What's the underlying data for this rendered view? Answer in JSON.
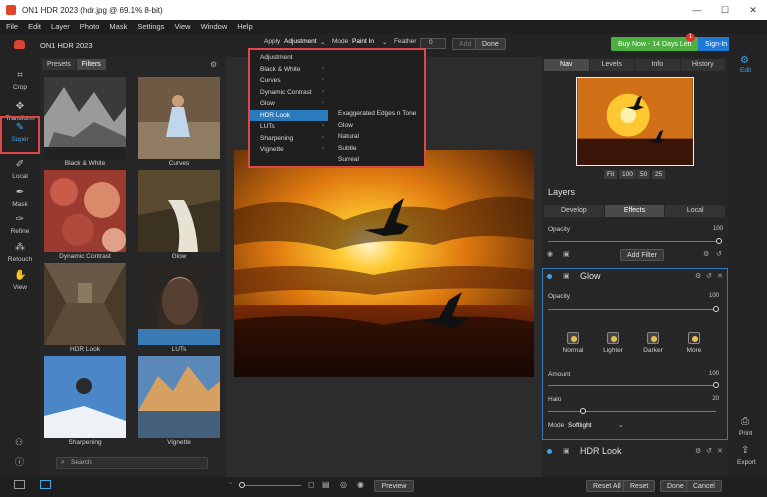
{
  "window": {
    "title": "ON1 HDR 2023 (hdr.jpg @ 69.1% 8-bit)",
    "controls": {
      "minimize": "—",
      "maximize": "☐",
      "close": "✕"
    }
  },
  "menu": [
    "File",
    "Edit",
    "Layer",
    "Photo",
    "Mask",
    "Settings",
    "View",
    "Window",
    "Help"
  ],
  "brand": {
    "name": "ON1 HDR 2023"
  },
  "header": {
    "buy_label": "Buy Now - 14 Days Left",
    "buy_badge": "1",
    "signin_label": "Sign-In",
    "edit_label": "Edit"
  },
  "toolbar": {
    "apply_label": "Apply",
    "apply_value": "Adjustment",
    "mode_label": "Mode",
    "mode_value": "Paint In",
    "feather_label": "Feather",
    "feather_value": "0",
    "add_label": "Add",
    "done_label": "Done"
  },
  "tools": [
    {
      "label": "Crop",
      "icon": "crop-icon",
      "glyph": "⌗"
    },
    {
      "label": "Transform",
      "icon": "transform-icon",
      "glyph": "✥"
    },
    {
      "label": "Super",
      "icon": "super-brush-icon",
      "glyph": "✎"
    },
    {
      "label": "Local",
      "icon": "local-brush-icon",
      "glyph": "✐"
    },
    {
      "label": "Mask",
      "icon": "mask-icon",
      "glyph": "✒"
    },
    {
      "label": "Refine",
      "icon": "refine-icon",
      "glyph": "✑"
    },
    {
      "label": "Retouch",
      "icon": "retouch-icon",
      "glyph": "⁂"
    },
    {
      "label": "View",
      "icon": "view-icon",
      "glyph": "✋"
    }
  ],
  "browser": {
    "tabs": [
      "Presets",
      "Filters"
    ],
    "filters": [
      "Black & White",
      "Curves",
      "Dynamic Contrast",
      "Glow",
      "HDR Look",
      "LUTs",
      "Sharpening",
      "Vignette"
    ],
    "search_placeholder": "Search"
  },
  "dropdown": {
    "items": [
      "Adjustment",
      "Black & White",
      "Curves",
      "Dynamic Contrast",
      "Glow",
      "HDR Look",
      "LUTs",
      "Sharpening",
      "Vignette"
    ],
    "selected": "HDR Look",
    "submenu": [
      "Exaggerated Edges n Tone",
      "Glow",
      "Natural",
      "Subtle",
      "Surreal"
    ]
  },
  "nav": {
    "tabs": [
      "Nav",
      "Levels",
      "Info",
      "History"
    ],
    "zoom": [
      "Fit",
      "100",
      "50",
      "25"
    ]
  },
  "layers": {
    "title": "Layers",
    "tabs": [
      "Develop",
      "Effects",
      "Local"
    ],
    "opacity_label": "Opacity",
    "opacity_value": "100",
    "add_filter_label": "Add Filter"
  },
  "glow": {
    "title": "Glow",
    "opacity_label": "Opacity",
    "opacity_value": "100",
    "presets": [
      "Normal",
      "Lighter",
      "Darker",
      "More"
    ],
    "amount_label": "Amount",
    "amount_value": "100",
    "halo_label": "Halo",
    "halo_value": "20",
    "mode_label": "Mode",
    "mode_value": "Softlight"
  },
  "hdr_look": {
    "title": "HDR Look"
  },
  "right_rail": {
    "print_label": "Print",
    "export_label": "Export"
  },
  "bottom": {
    "preview_label": "Preview",
    "reset_all_label": "Reset All",
    "reset_label": "Reset",
    "done_label": "Done",
    "cancel_label": "Cancel"
  },
  "colors": {
    "accent": "#3ea6e8",
    "highlight": "#e04848",
    "buy": "#4caf3f",
    "signin": "#1e7ad6"
  }
}
